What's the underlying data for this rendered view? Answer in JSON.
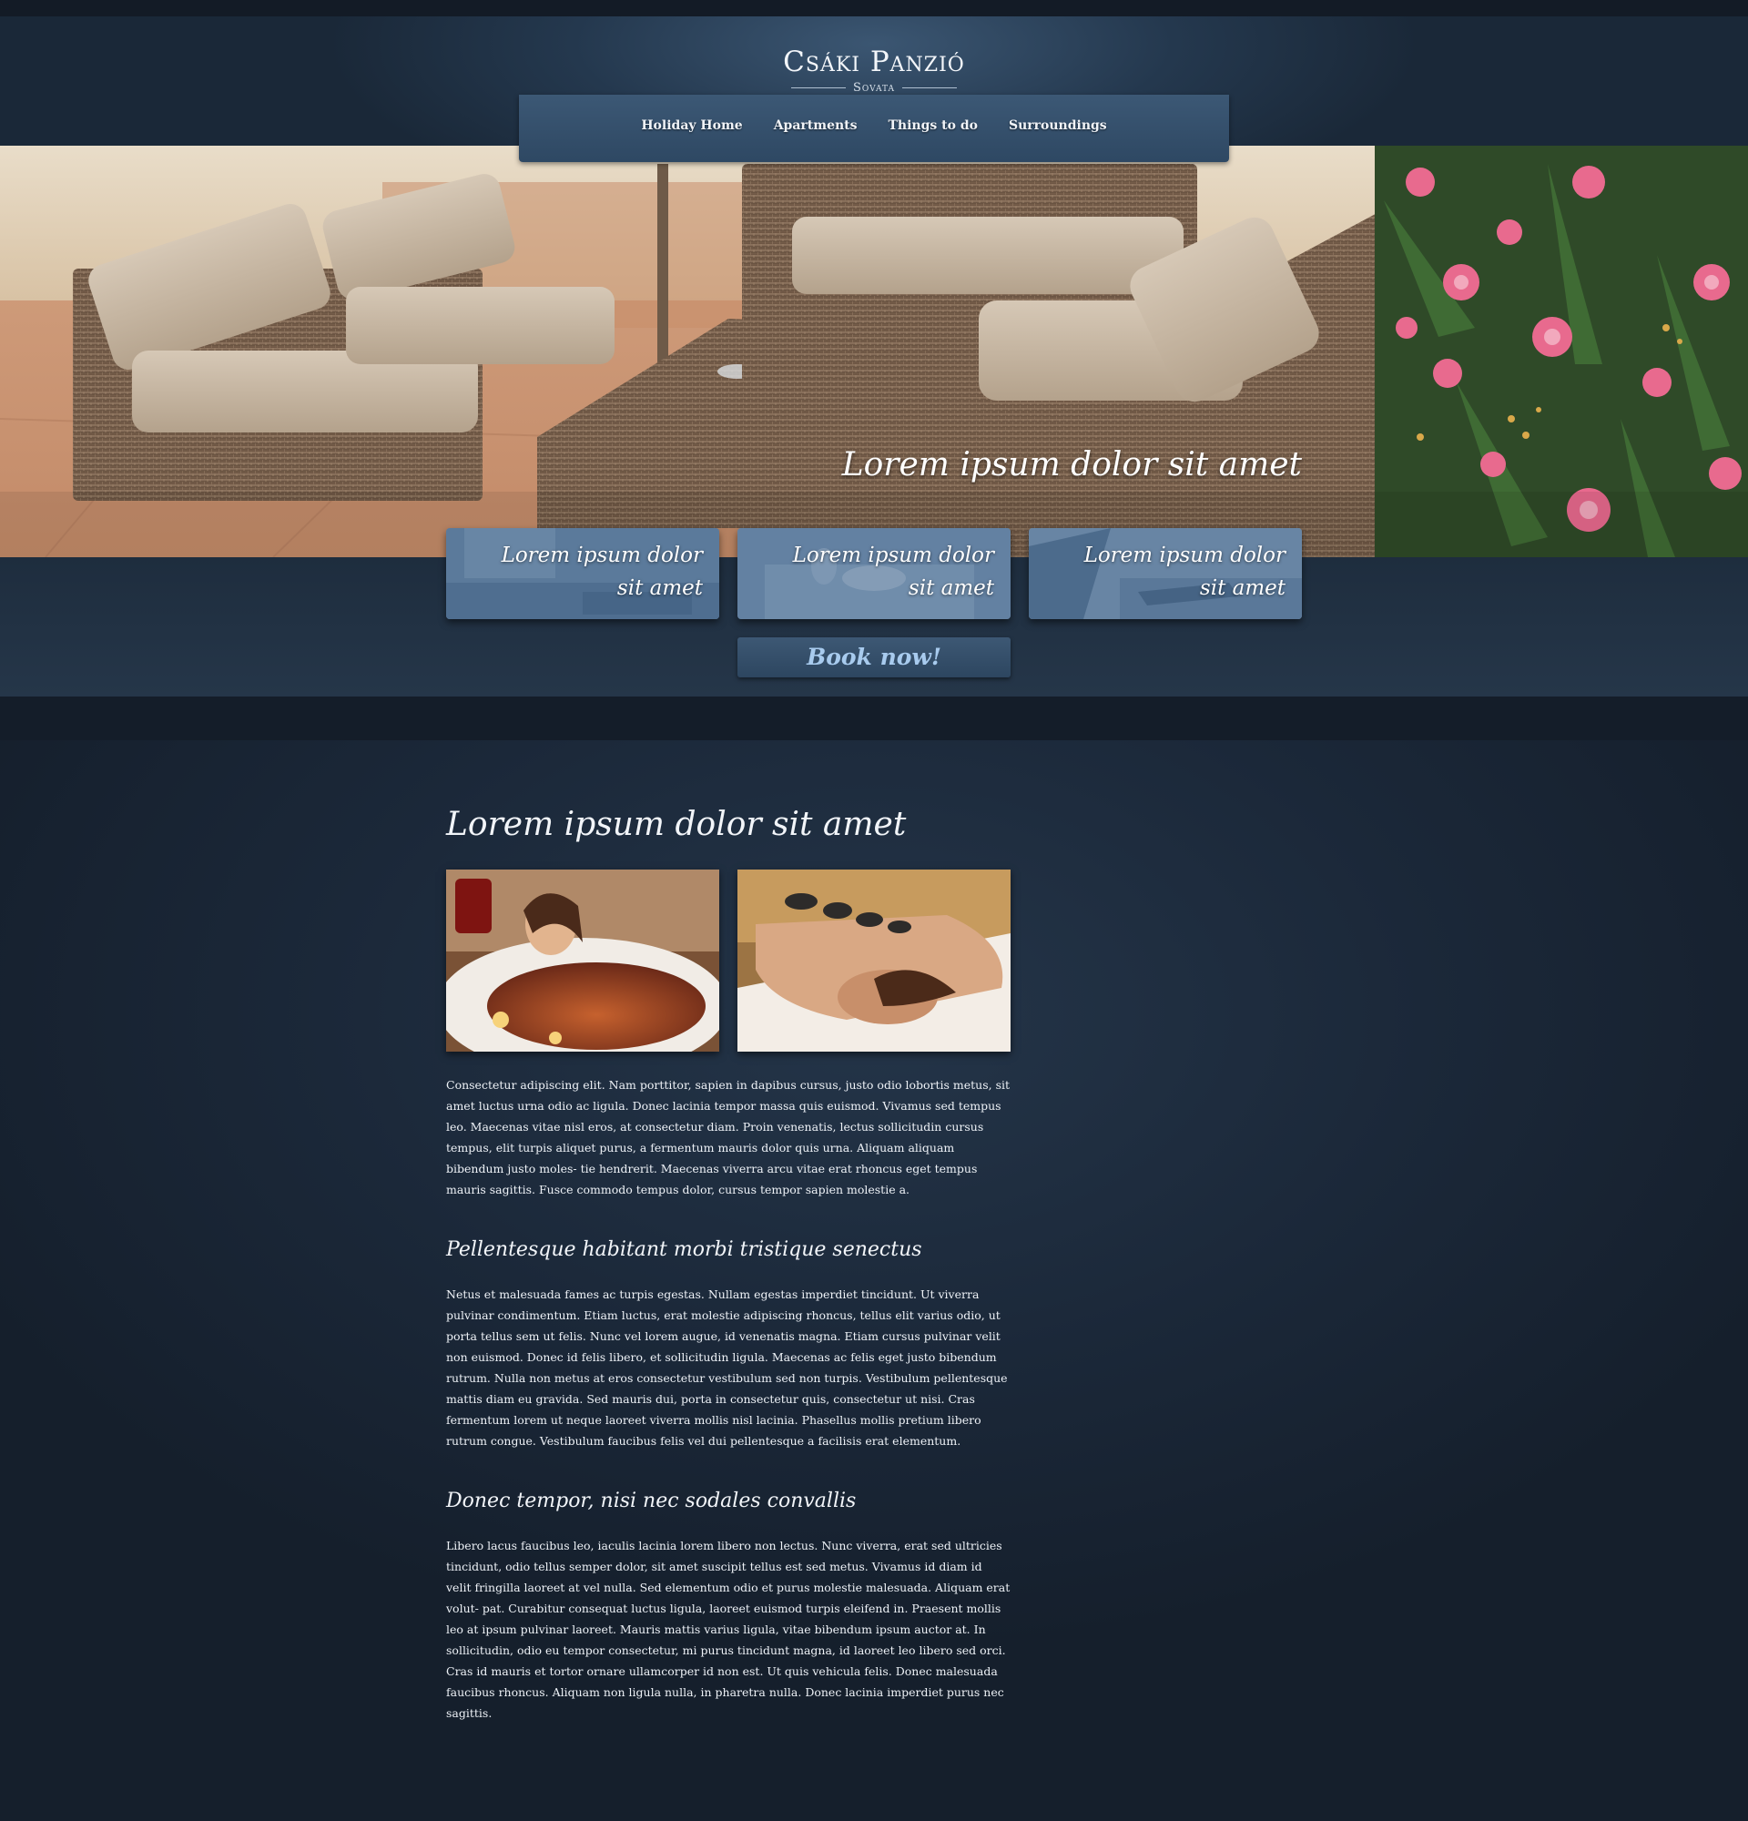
{
  "site": {
    "name": "Csáki Panzió",
    "location": "Sovata"
  },
  "nav": {
    "items": [
      {
        "label": "Holiday Home"
      },
      {
        "label": "Apartments"
      },
      {
        "label": "Things to do"
      },
      {
        "label": "Surroundings"
      }
    ]
  },
  "hero": {
    "caption": "Lorem ipsum dolor sit amet"
  },
  "features": [
    {
      "label": "Lorem ipsum dolor sit amet"
    },
    {
      "label": "Lorem ipsum dolor sit amet"
    },
    {
      "label": "Lorem ipsum dolor sit amet"
    }
  ],
  "cta": {
    "label": "Book now!"
  },
  "main": {
    "title": "Lorem ipsum dolor sit amet",
    "intro": "Consectetur adipiscing elit. Nam porttitor, sapien in dapibus cursus, justo odio lobortis metus, sit amet luctus urna odio ac ligula. Donec lacinia tempor massa quis euismod. Vivamus sed tempus leo. Maecenas vitae nisl eros, at consectetur diam. Proin venenatis, lectus sollicitudin cursus tempus, elit turpis aliquet purus, a fermentum mauris dolor quis urna. Aliquam aliquam bibendum justo moles- tie hendrerit. Maecenas viverra arcu vitae erat rhoncus eget tempus mauris sagittis. Fusce commodo tempus dolor, cursus tempor sapien molestie a.",
    "sections": [
      {
        "heading": "Pellentesque habitant morbi tristique senectus",
        "body": "Netus et malesuada fames ac turpis egestas. Nullam egestas imperdiet tincidunt. Ut viverra pulvinar condimentum. Etiam luctus, erat molestie adipiscing rhoncus, tellus elit varius odio, ut porta tellus sem ut felis. Nunc vel lorem augue, id venenatis magna. Etiam cursus pulvinar velit non euismod. Donec id felis libero, et sollicitudin ligula. Maecenas ac felis eget justo bibendum rutrum. Nulla non metus at eros consectetur vestibulum sed non turpis. Vestibulum pellentesque mattis diam eu gravida. Sed mauris dui, porta in consectetur quis, consectetur ut nisi. Cras fermentum lorem ut neque laoreet viverra mollis nisl lacinia. Phasellus mollis pretium libero rutrum congue. Vestibulum faucibus felis vel dui pellentesque a facilisis erat elementum."
      },
      {
        "heading": "Donec tempor, nisi nec sodales convallis",
        "body": "Libero lacus faucibus leo, iaculis lacinia lorem libero non lectus. Nunc viverra, erat sed ultricies tincidunt, odio tellus semper dolor, sit amet suscipit tellus est sed metus. Vivamus id diam id velit fringilla laoreet at vel nulla. Sed elementum odio et purus molestie malesuada. Aliquam erat volut- pat. Curabitur consequat luctus ligula, laoreet euismod turpis eleifend in. Praesent mollis leo at ipsum pulvinar laoreet. Mauris mattis varius ligula, vitae bibendum ipsum auctor at. In sollicitudin, odio eu tempor consectetur, mi purus tincidunt magna, id laoreet leo libero sed orci. Cras id mauris et tortor ornare ullamcorper id non est. Ut quis vehicula felis. Donec malesuada faucibus rhoncus. Aliquam non ligula nulla, in pharetra nulla. Donec lacinia imperdiet purus nec sagittis."
      }
    ]
  },
  "colors": {
    "background": "#172231",
    "nav": "#34506c",
    "cta_text": "#a8cbee"
  }
}
